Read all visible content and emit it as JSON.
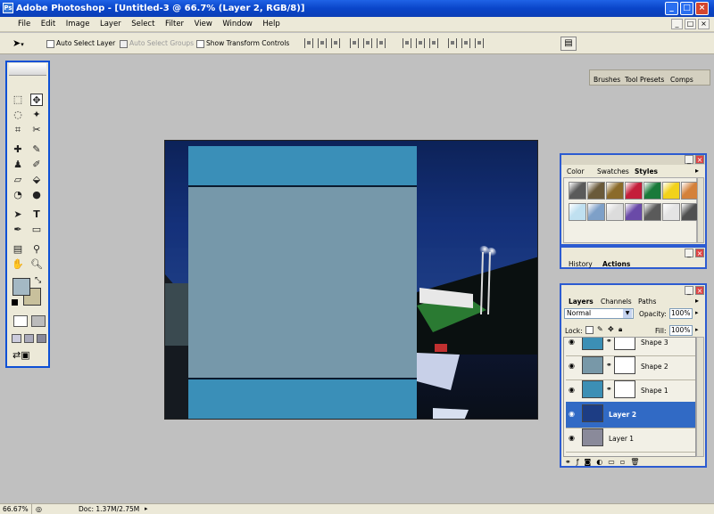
{
  "window": {
    "title": "Adobe Photoshop - [Untitled-3 @ 66.7% (Layer 2, RGB/8)]",
    "app_icon": "Ps"
  },
  "window_controls": {
    "minimize": "_",
    "restore": "□",
    "close": "×"
  },
  "menubar": {
    "items": [
      "File",
      "Edit",
      "Image",
      "Layer",
      "Select",
      "Filter",
      "View",
      "Window",
      "Help"
    ],
    "controls": {
      "minimize": "_",
      "restore": "□",
      "close": "×"
    }
  },
  "options": {
    "move_tool_icon": "move-tool",
    "auto_select_layer": "Auto Select Layer",
    "auto_select_groups": "Auto Select Groups",
    "show_transform_controls": "Show Transform Controls",
    "palette_tabs": [
      "Brushes",
      "Tool Presets",
      "Comps"
    ]
  },
  "styles_panel": {
    "tabs": [
      "Color",
      "Swatches",
      "Styles"
    ],
    "active_tab": "Styles",
    "swatches": [
      "#5a5a5a",
      "#6a5a3a",
      "#8b6b2a",
      "#c41e3a",
      "#1a7a3a",
      "#f2d21a",
      "#d4813a",
      "#bfe0f0",
      "#7ea0c8",
      "#dcdcdc",
      "#6a4aa8",
      "#5a5a5a",
      "#e4e4e4",
      "#505050"
    ]
  },
  "actions_panel": {
    "tabs": [
      "History",
      "Actions"
    ],
    "active_tab": "Actions"
  },
  "layers_panel": {
    "tabs": [
      "Layers",
      "Channels",
      "Paths"
    ],
    "active_tab": "Layers",
    "blend_mode": "Normal",
    "opacity_label": "Opacity:",
    "opacity_value": "100%",
    "lock_label": "Lock:",
    "fill_label": "Fill:",
    "fill_value": "100%",
    "layers": [
      {
        "name": "Shape 3",
        "color": "#3c8fb5",
        "selected": false
      },
      {
        "name": "Shape 2",
        "color": "#7898a8",
        "selected": false
      },
      {
        "name": "Shape 1",
        "color": "#3c8fb5",
        "selected": false
      },
      {
        "name": "Layer 2",
        "color": "#1d3d84",
        "selected": true
      },
      {
        "name": "Layer 1",
        "color": "#8a8a9a",
        "selected": false
      }
    ]
  },
  "canvas": {
    "shape_colors": [
      "#3a8fb8",
      "#7698aa"
    ]
  },
  "statusbar": {
    "zoom": "66.67%",
    "doc": "Doc: 1.37M/2.75M"
  },
  "colors": {
    "titlebar": "#0b45c8",
    "panel": "#ece9d8",
    "selection": "#316ac5",
    "foreground": "#a4b8c4",
    "background": "#c8c09c"
  }
}
